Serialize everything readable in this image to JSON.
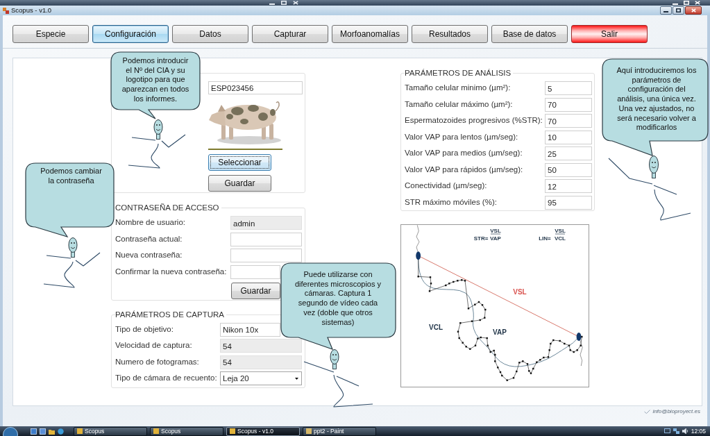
{
  "window": {
    "title": "Scopus - v1.0"
  },
  "toolbar_buttons": [
    {
      "label": "Especie",
      "selected": false,
      "kind": "normal"
    },
    {
      "label": "Configuración",
      "selected": true,
      "kind": "normal"
    },
    {
      "label": "Datos",
      "selected": false,
      "kind": "normal"
    },
    {
      "label": "Capturar",
      "selected": false,
      "kind": "normal"
    },
    {
      "label": "Morfoanomalías",
      "selected": false,
      "kind": "normal"
    },
    {
      "label": "Resultados",
      "selected": false,
      "kind": "normal"
    },
    {
      "label": "Base de datos",
      "selected": false,
      "kind": "normal"
    },
    {
      "label": "Salir",
      "selected": false,
      "kind": "exit"
    }
  ],
  "logo_group": {
    "cia_number": "ESP023456",
    "buttons": [
      {
        "label": "Seleccionar",
        "focused": true
      },
      {
        "label": "Guardar",
        "focused": false
      }
    ]
  },
  "password_group": {
    "title": "CONTRASEÑA DE ACCESO",
    "fields": [
      {
        "label": "Nombre de usuario:",
        "value": "admin",
        "readonly": true
      },
      {
        "label": "Contraseña actual:",
        "readonly": false
      },
      {
        "label": "Nueva contraseña:",
        "readonly": false
      },
      {
        "label": "Confirmar la nueva contraseña:",
        "readonly": false
      }
    ],
    "save_button": "Guardar"
  },
  "capture_group": {
    "title": "PARÁMETROS DE CAPTURA",
    "fields": [
      {
        "label": "Tipo de objetivo:",
        "value": "Nikon 10x",
        "kind": "text",
        "readonly": false
      },
      {
        "label": "Velocidad de captura:",
        "value": "54",
        "kind": "text",
        "readonly": true
      },
      {
        "label": "Numero de fotogramas:",
        "value": "54",
        "kind": "text",
        "readonly": true
      },
      {
        "label": "Tipo de cámara de recuento:",
        "value": "Leja 20",
        "kind": "select",
        "readonly": false
      }
    ]
  },
  "analysis_group": {
    "title": "PARÁMETROS DE ANÁLISIS",
    "fields": [
      {
        "label": "Tamaño celular minimo (µm²):",
        "value": "5"
      },
      {
        "label": "Tamaño celular máximo (µm²):",
        "value": "70"
      },
      {
        "label": "Espermatozoides progresivos (%STR):",
        "value": "70"
      },
      {
        "label": "Valor VAP para lentos (µm/seg):",
        "value": "10"
      },
      {
        "label": "Valor VAP para medios (µm/seg):",
        "value": "25"
      },
      {
        "label": "Valor VAP para rápidos (µm/seg):",
        "value": "50"
      },
      {
        "label": "Conectividad (µm/seg):",
        "value": "12"
      },
      {
        "label": "STR máximo móviles (%):",
        "value": "95"
      }
    ]
  },
  "diagram": {
    "formulas": [
      {
        "label": "STR=",
        "numerator": "VSL",
        "denominator": "VAP"
      },
      {
        "label": "LIN=",
        "numerator": "VSL",
        "denominator": "VCL"
      }
    ],
    "path_labels": [
      {
        "text": "VSL",
        "color": "#d9534f"
      },
      {
        "text": "VCL",
        "color": "#1f3347"
      },
      {
        "text": "VAP",
        "color": "#1f3347"
      }
    ]
  },
  "callouts": [
    {
      "text": "Podemos introducir el Nº del CIA y su logotipo para que aparezcan en todos los informes."
    },
    {
      "text": "Podemos cambiar la contraseña"
    },
    {
      "text": "Puede utilizarse con diferentes microscopios y cámaras. Captura 1 segundo de vídeo cada vez (doble que otros sistemas)"
    },
    {
      "text": "Aquí introduciremos los parámetros de configuración del análisis, una única vez. Una vez ajustados, no será necesario volver a modificarlos"
    }
  ],
  "footer": {
    "email": "info@bioproyect.es"
  },
  "taskbar": {
    "tasks": [
      {
        "label": "Scopus",
        "selected": false
      },
      {
        "label": "Scopus",
        "selected": false
      },
      {
        "label": "Scopus - v1.0",
        "selected": true
      },
      {
        "label": "ppt2 - Paint",
        "selected": false
      }
    ],
    "clock": "12:05"
  }
}
